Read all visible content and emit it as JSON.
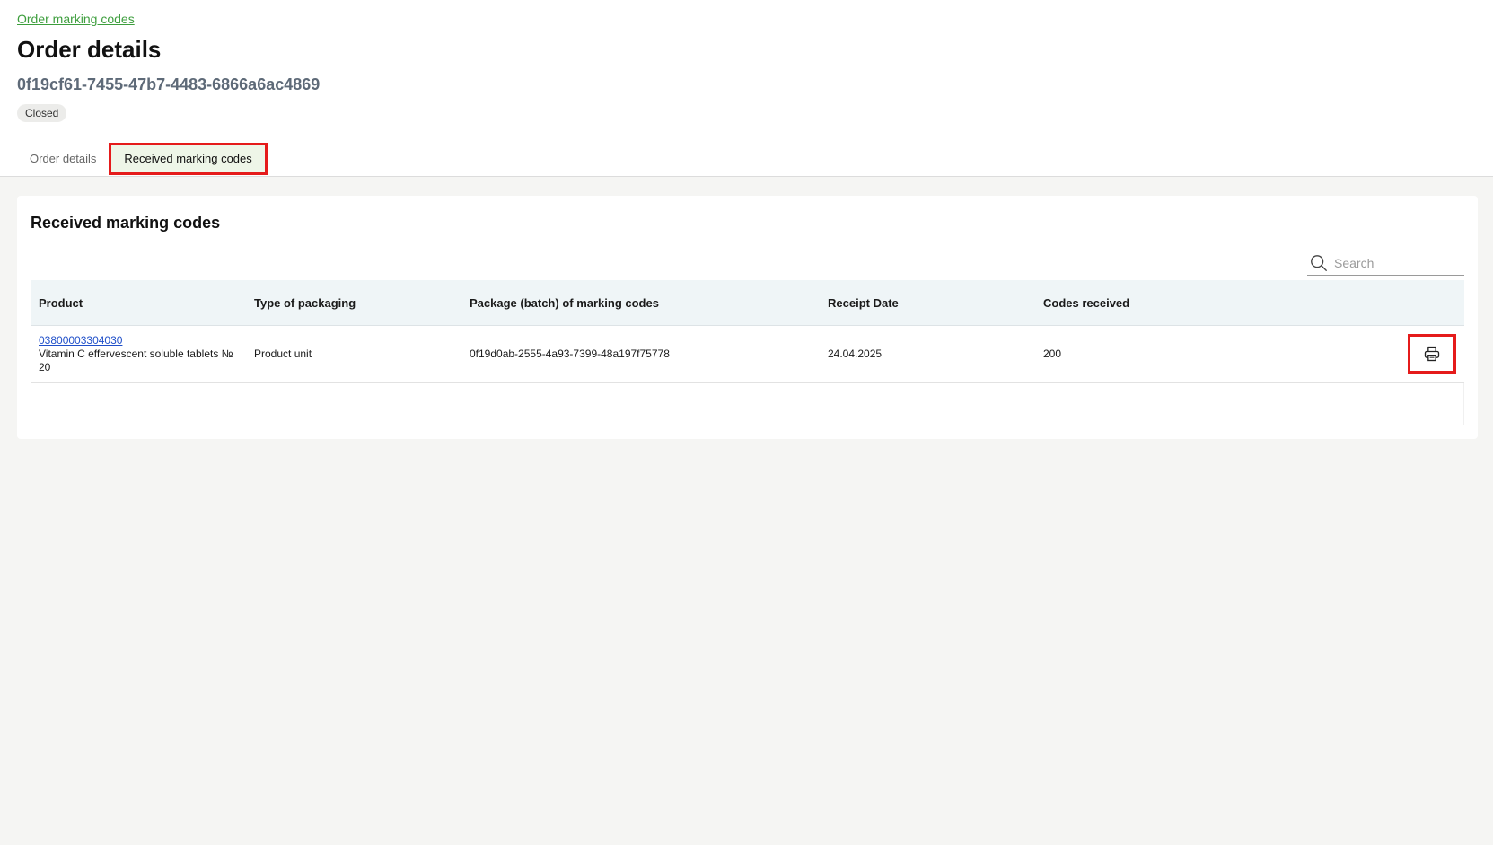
{
  "breadcrumb": {
    "label": "Order marking codes"
  },
  "page": {
    "title": "Order details",
    "order_id": "0f19cf61-7455-47b7-4483-6866a6ac4869",
    "status": "Closed"
  },
  "tabs": [
    {
      "label": "Order details",
      "active": false
    },
    {
      "label": "Received marking codes",
      "active": true
    }
  ],
  "card": {
    "title": "Received marking codes"
  },
  "search": {
    "placeholder": "Search",
    "icon": "search-icon"
  },
  "table": {
    "headers": [
      "Product",
      "Type of packaging",
      "Package (batch) of marking codes",
      "Receipt Date",
      "Codes received"
    ],
    "rows": [
      {
        "product_code": "03800003304030",
        "product_name": "Vitamin C effervescent soluble tablets № 20",
        "packaging": "Product unit",
        "package": "0f19d0ab-2555-4a93-7399-48a197f75778",
        "receipt_date": "24.04.2025",
        "codes_received": "200",
        "action_icon": "printer-icon"
      }
    ]
  },
  "colors": {
    "accent_green": "#3d9e3d",
    "highlight_red": "#e51b1b",
    "link_blue": "#1f4fc9"
  }
}
